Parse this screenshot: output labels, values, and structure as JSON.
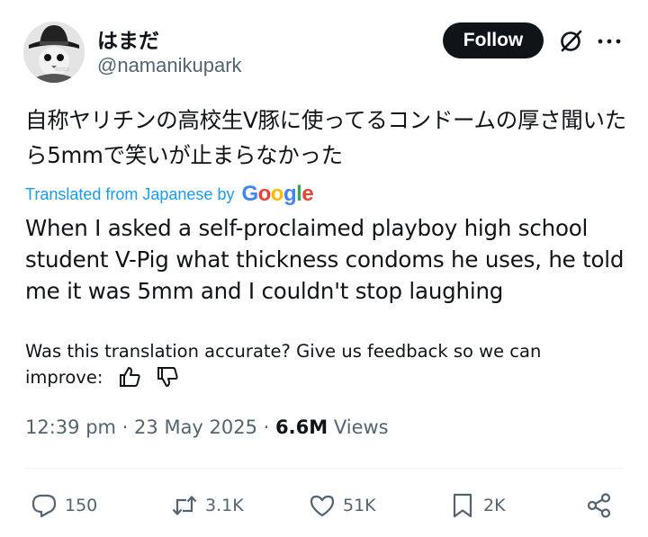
{
  "author": {
    "display_name": "はまだ",
    "handle": "@namanikupark",
    "avatar_icon": "cat-in-fedora-avatar"
  },
  "header": {
    "follow_label": "Follow",
    "grok_icon": "grok-icon",
    "more_icon": "more-icon"
  },
  "post": {
    "original_text": "自称ヤリチンの高校生V豚に使ってるコンドームの厚さ聞いたら5mmで笑いが止まらなかった",
    "translated_by_label": "Translated from Japanese by",
    "translated_by_brand": "Google",
    "translation": "When I asked a self-proclaimed playboy high school student V-Pig what thickness condoms he uses, he told me it was 5mm and I couldn't stop laughing",
    "feedback_prompt": "Was this translation accurate? Give us feedback so we can improve:"
  },
  "meta": {
    "time": "12:39 pm",
    "separator": "·",
    "date": "23 May 2025",
    "views_count": "6.6M",
    "views_label": "Views"
  },
  "actions": {
    "replies": "150",
    "reposts": "3.1K",
    "likes": "51K",
    "bookmarks": "2K"
  },
  "colors": {
    "text": "#0f1419",
    "secondary": "#536471",
    "link": "#1d9bf0",
    "button_bg": "#0f1419",
    "divider": "#eff3f4"
  }
}
